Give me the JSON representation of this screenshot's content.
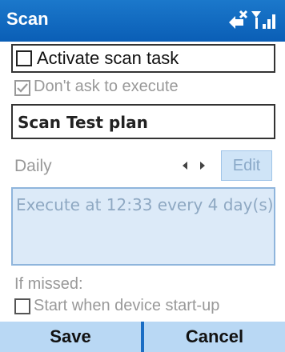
{
  "titlebar": {
    "title": "Scan"
  },
  "activate": {
    "label": "Activate scan task",
    "checked": false
  },
  "dont_ask": {
    "label": "Don't ask to execute",
    "checked": true,
    "enabled": false
  },
  "plan_name": {
    "value": "Scan Test plan"
  },
  "schedule": {
    "frequency": "Daily",
    "edit_label": "Edit"
  },
  "details": {
    "text": "Execute at 12:33 every 4 day(s)"
  },
  "missed": {
    "label": "If missed:"
  },
  "startup": {
    "label": "Start when device start-up",
    "checked": false
  },
  "softkeys": {
    "left": "Save",
    "right": "Cancel"
  },
  "colors": {
    "accent": "#0a5eb6",
    "softkey_bg": "#b9d8f4",
    "details_bg": "#dceaf8"
  },
  "icons": [
    "connectivity-icon",
    "signal-icon"
  ]
}
